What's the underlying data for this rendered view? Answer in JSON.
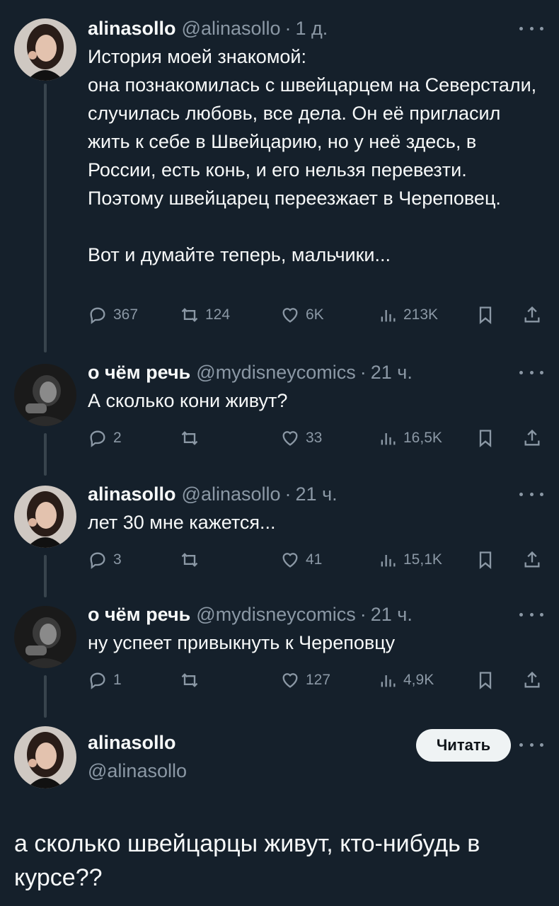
{
  "tweets": [
    {
      "name": "alinasollo",
      "handle": "@alinasollo",
      "dot": "·",
      "time": "1 д.",
      "text": "История моей знакомой:\nона познакомилась с швейцарцем на Северстали, случилась любовь, все дела. Он её пригласил жить к себе в Швейцарию, но у неё здесь, в России, есть конь, и его нельзя перевезти. Поэтому швейцарец переезжает в Череповец.\n\nВот и думайте теперь, мальчики...",
      "replies": "367",
      "retweets": "124",
      "likes": "6K",
      "views": "213K",
      "avatar_icon": "woman-portrait-avatar"
    },
    {
      "name": "о чём речь",
      "handle": "@mydisneycomics",
      "dot": "·",
      "time": "21 ч.",
      "text": "А сколько кони живут?",
      "replies": "2",
      "retweets": "",
      "likes": "33",
      "views": "16,5K",
      "avatar_icon": "dark-portrait-avatar"
    },
    {
      "name": "alinasollo",
      "handle": "@alinasollo",
      "dot": "·",
      "time": "21 ч.",
      "text": "лет 30 мне кажется...",
      "replies": "3",
      "retweets": "",
      "likes": "41",
      "views": "15,1K",
      "avatar_icon": "woman-portrait-avatar"
    },
    {
      "name": "о чём речь",
      "handle": "@mydisneycomics",
      "dot": "·",
      "time": "21 ч.",
      "text": "ну успеет привыкнуть к Череповцу",
      "replies": "1",
      "retweets": "",
      "likes": "127",
      "views": "4,9K",
      "avatar_icon": "dark-portrait-avatar"
    }
  ],
  "main_tweet": {
    "name": "alinasollo",
    "handle": "@alinasollo",
    "follow_label": "Читать",
    "text": "а сколько швейцарцы живут, кто-нибудь в курсе??",
    "avatar_icon": "woman-portrait-avatar"
  },
  "colors": {
    "background": "#15202b",
    "text": "#f7f9f9",
    "secondary": "#8b98a5",
    "thread_line": "#38444d",
    "button_bg": "#eff3f4"
  }
}
